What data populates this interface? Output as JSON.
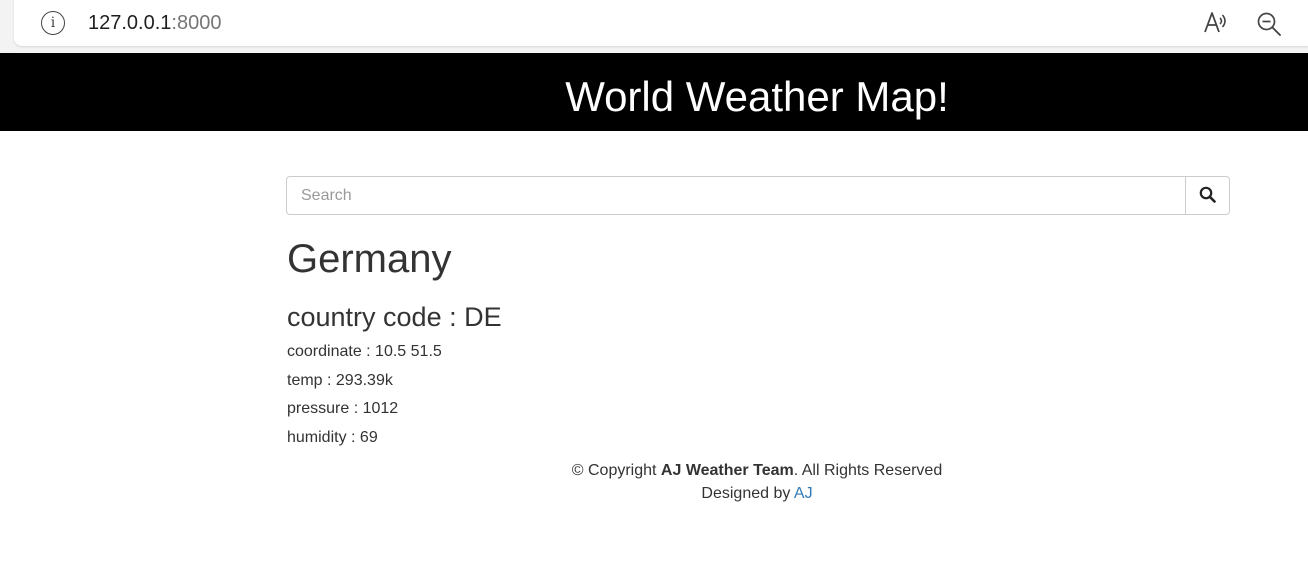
{
  "browser": {
    "url_host": "127.0.0.1",
    "url_port": ":8000",
    "icons": {
      "site_info": "info-icon",
      "read_aloud": "read-aloud-icon",
      "zoom_out": "zoom-out-icon"
    },
    "info_glyph": "i"
  },
  "header": {
    "title": "World Weather Map!"
  },
  "search": {
    "placeholder": "Search",
    "value": "",
    "button_icon": "search-icon"
  },
  "weather": {
    "country": "Germany",
    "country_code_label": "country code : DE",
    "coordinate": "coordinate : 10.5 51.5",
    "temp": "temp : 293.39k",
    "pressure": "pressure : 1012",
    "humidity": "humidity : 69"
  },
  "footer": {
    "copyright_prefix": "© Copyright ",
    "team": "AJ Weather Team",
    "copyright_suffix": ". All Rights Reserved",
    "designed_by": "Designed by ",
    "designer": "AJ"
  },
  "colors": {
    "header_bg": "#000000",
    "header_text": "#ffffff",
    "link": "#337ab7",
    "text": "#333333"
  }
}
